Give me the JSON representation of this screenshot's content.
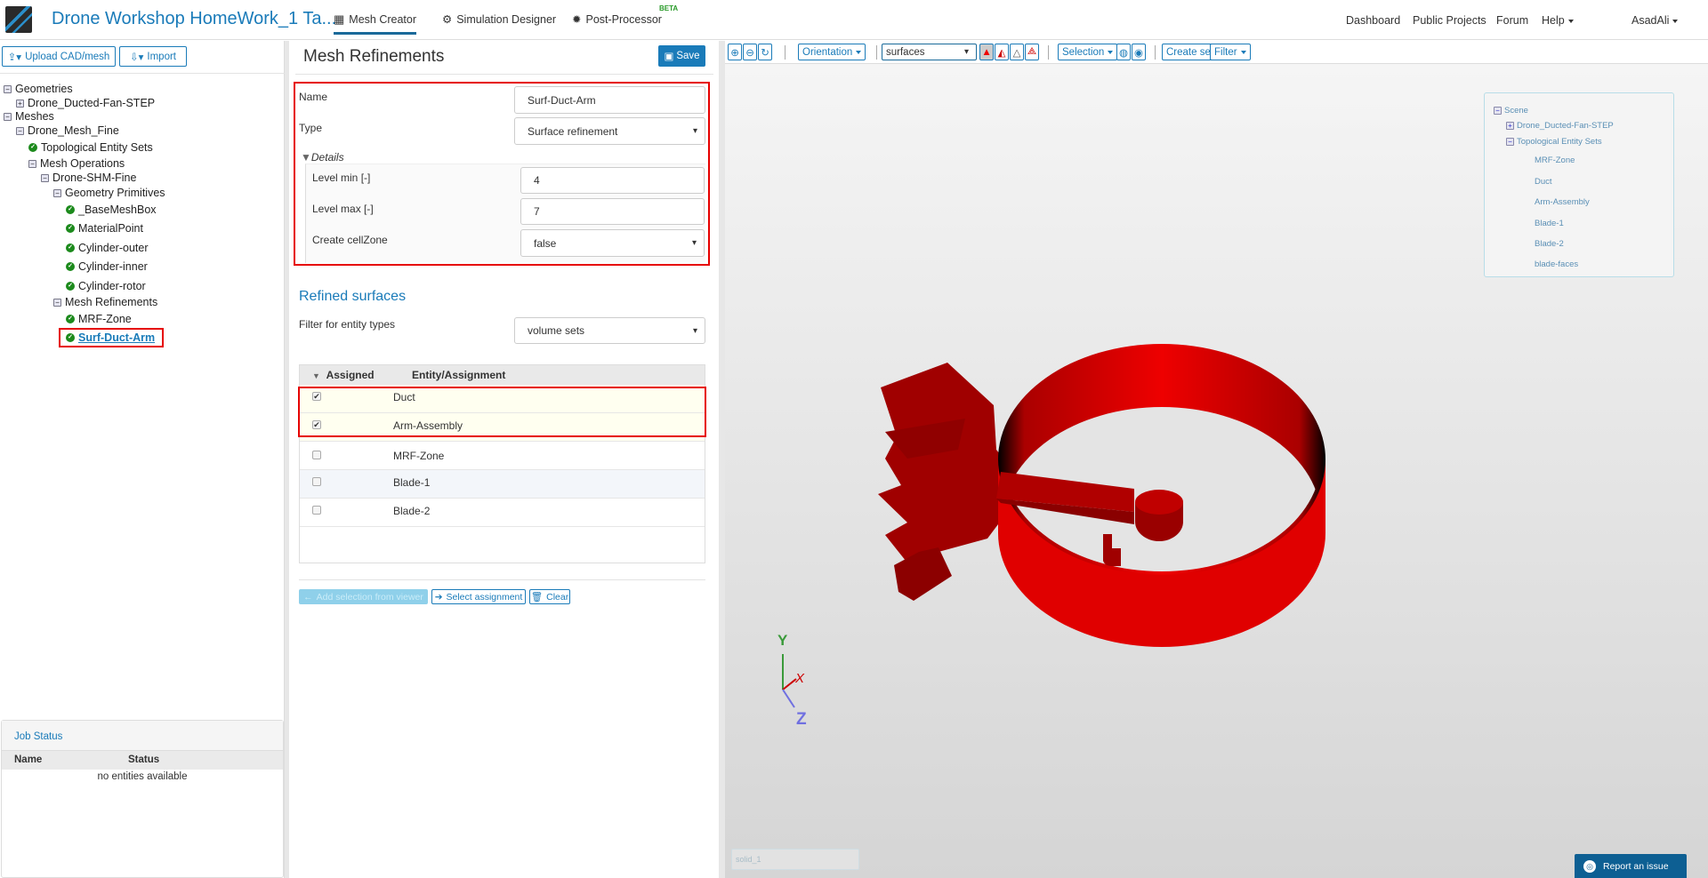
{
  "header": {
    "title": "Drone Workshop HomeWork_1 Ta...",
    "tabs": [
      "Mesh Creator",
      "Simulation Designer",
      "Post-Processor"
    ],
    "beta": "BETA",
    "links": [
      "Dashboard",
      "Public Projects",
      "Forum",
      "Help"
    ],
    "user": "AsadAli"
  },
  "left": {
    "upload": "Upload CAD/mesh",
    "import": "Import",
    "tree": [
      {
        "label": "Geometries",
        "icon": "collapse"
      },
      {
        "label": "Drone_Ducted-Fan-STEP",
        "icon": "expand"
      },
      {
        "label": "Meshes",
        "icon": "collapse"
      },
      {
        "label": "Drone_Mesh_Fine",
        "icon": "collapse"
      },
      {
        "label": "Topological Entity Sets",
        "icon": "check"
      },
      {
        "label": "Mesh Operations",
        "icon": "collapse"
      },
      {
        "label": "Drone-SHM-Fine",
        "icon": "collapse"
      },
      {
        "label": "Geometry Primitives",
        "icon": "collapse"
      },
      {
        "label": "_BaseMeshBox",
        "icon": "check"
      },
      {
        "label": "MaterialPoint",
        "icon": "check"
      },
      {
        "label": "Cylinder-outer",
        "icon": "check"
      },
      {
        "label": "Cylinder-inner",
        "icon": "check"
      },
      {
        "label": "Cylinder-rotor",
        "icon": "check"
      },
      {
        "label": "Mesh Refinements",
        "icon": "collapse"
      },
      {
        "label": "MRF-Zone",
        "icon": "check"
      },
      {
        "label": "Surf-Duct-Arm",
        "icon": "check"
      }
    ],
    "job_status": {
      "title": "Job Status",
      "col_name": "Name",
      "col_status": "Status",
      "empty": "no entities available"
    }
  },
  "mid": {
    "title": "Mesh Refinements",
    "save": "Save",
    "name_label": "Name",
    "name_value": "Surf-Duct-Arm",
    "type_label": "Type",
    "type_value": "Surface refinement",
    "details": "Details",
    "level_min_label": "Level min [-]",
    "level_min": "4",
    "level_max_label": "Level max [-]",
    "level_max": "7",
    "cellzone_label": "Create cellZone",
    "cellzone_value": "false",
    "refined_title": "Refined surfaces",
    "filter_label": "Filter for entity types",
    "filter_value": "volume sets",
    "col_assigned": "Assigned",
    "col_entity": "Entity/Assignment",
    "rows": [
      {
        "name": "Duct",
        "checked": true
      },
      {
        "name": "Arm-Assembly",
        "checked": true
      },
      {
        "name": "MRF-Zone",
        "checked": false
      },
      {
        "name": "Blade-1",
        "checked": false
      },
      {
        "name": "Blade-2",
        "checked": false
      }
    ],
    "add_selection": "Add selection from viewer",
    "select_assignment": "Select assignment",
    "clear": "Clear"
  },
  "viewer": {
    "orientation": "Orientation",
    "render_mode": "surfaces",
    "selection": "Selection",
    "create_set": "Create set",
    "filter": "Filter",
    "scene_tree": [
      "Scene",
      "Drone_Ducted-Fan-STEP",
      "Topological Entity Sets",
      "MRF-Zone",
      "Duct",
      "Arm-Assembly",
      "Blade-1",
      "Blade-2",
      "blade-faces"
    ],
    "axes": [
      "Y",
      "X",
      "Z"
    ],
    "solid_label": "solid_1",
    "report": "Report an issue",
    "model_color": "#e60000"
  }
}
